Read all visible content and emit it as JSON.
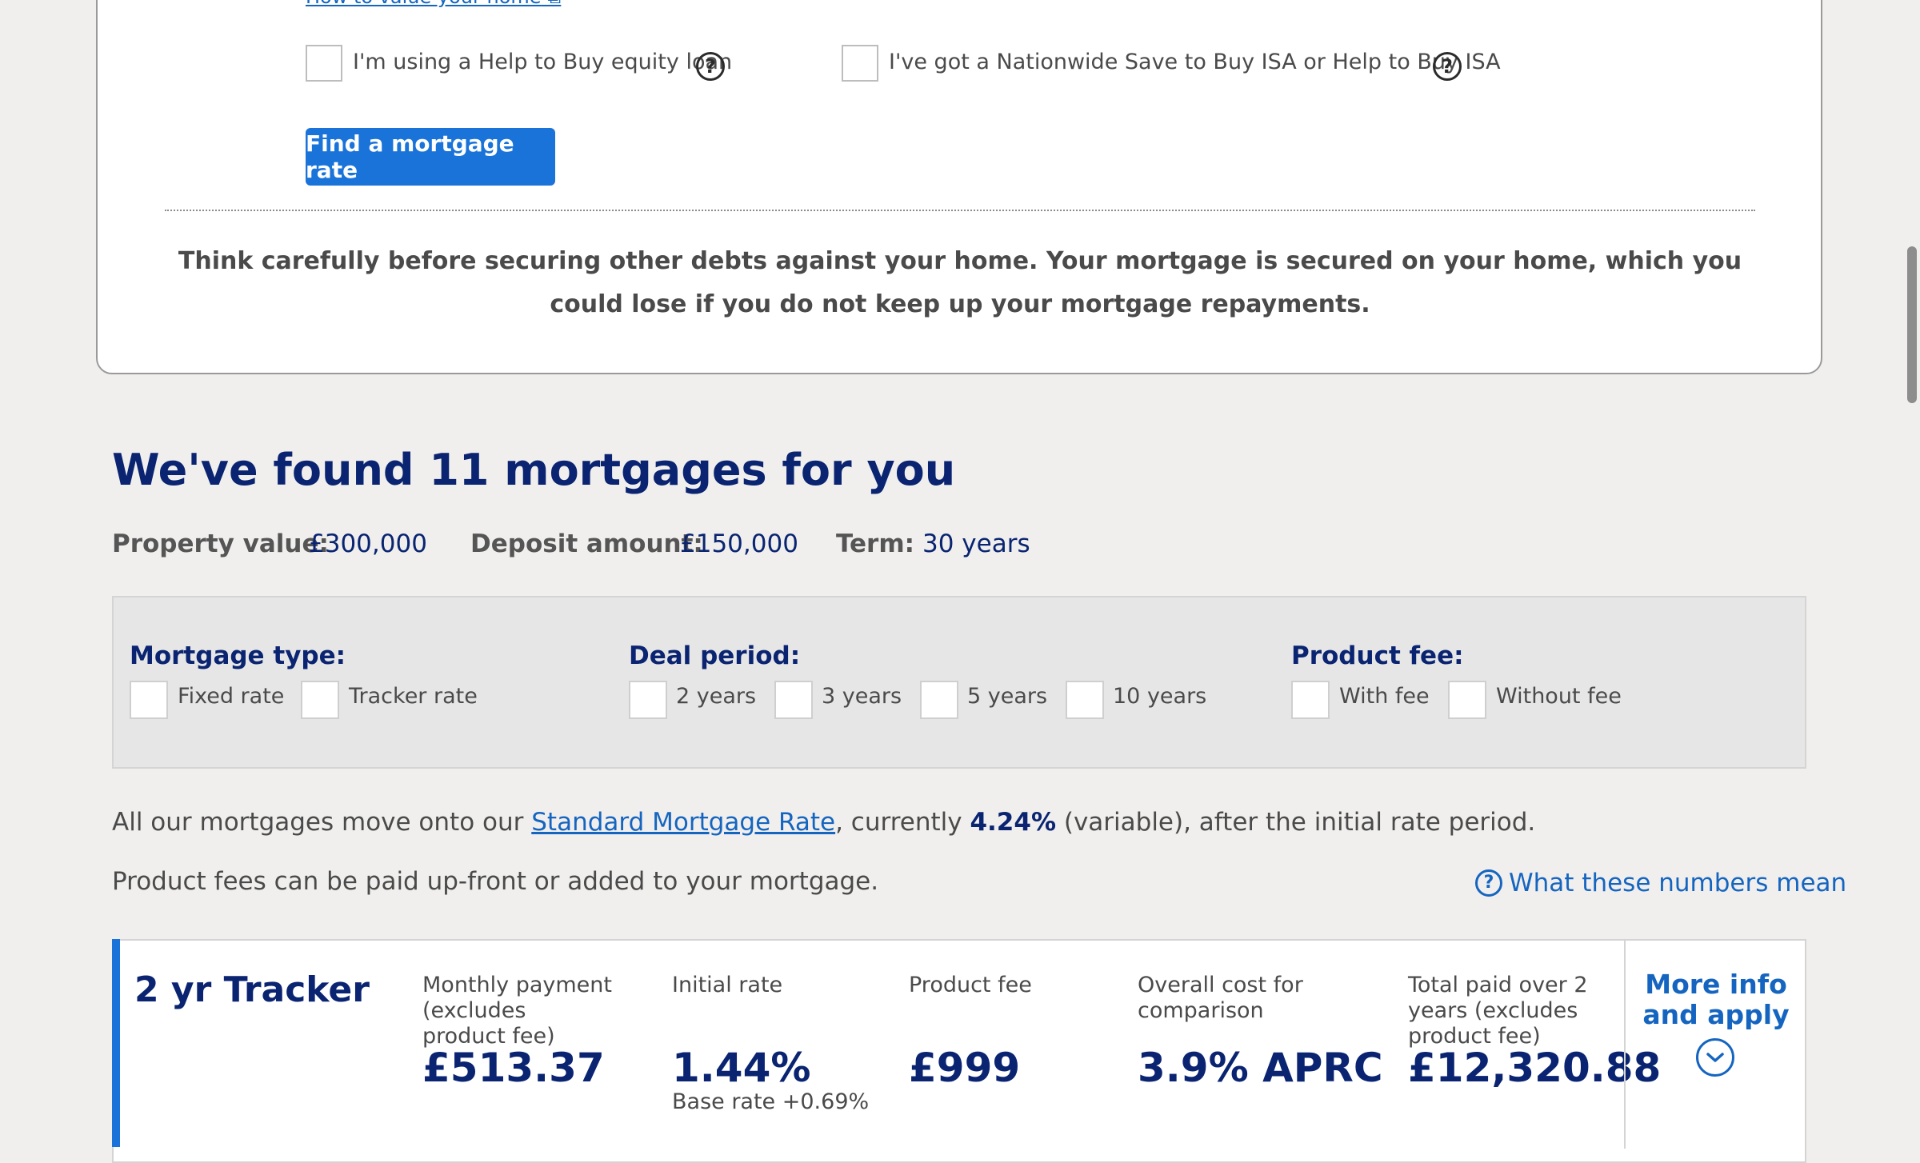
{
  "search_form": {
    "value_link": "How to value your home",
    "options": [
      {
        "label": "I'm using a Help to Buy equity loan"
      },
      {
        "label": "I've got a Nationwide Save to Buy ISA or Help to Buy ISA"
      }
    ],
    "help_glyph": "?",
    "find_button": "Find a mortgage rate",
    "warning": "Think carefully before securing other debts against your home. Your mortgage is secured on your home, which you could lose if you do not keep up your mortgage repayments."
  },
  "results": {
    "title": "We've found 11 mortgages for you",
    "summary": {
      "property_label": "Property value:",
      "property_value": "£300,000",
      "deposit_label": "Deposit amount:",
      "deposit_value": "£150,000",
      "term_label": "Term:",
      "term_value": "30 years"
    }
  },
  "filters": {
    "mortgage_type": {
      "title": "Mortgage type:",
      "options": [
        "Fixed rate",
        "Tracker rate"
      ]
    },
    "deal_period": {
      "title": "Deal period:",
      "options": [
        "2 years",
        "3 years",
        "5 years",
        "10 years"
      ]
    },
    "product_fee": {
      "title": "Product fee:",
      "options": [
        "With fee",
        "Without fee"
      ]
    }
  },
  "info": {
    "line1_pre": "All our mortgages move onto our ",
    "line1_link": "Standard Mortgage Rate",
    "line1_mid": ", currently ",
    "line1_rate": "4.24%",
    "line1_post": " (variable), after the initial rate period.",
    "line2": "Product fees can be paid up-front or added to your mortgage.",
    "numbers_link": "What these numbers mean"
  },
  "product": {
    "name": "2 yr Tracker",
    "columns": [
      {
        "label": "Monthly payment (excludes product fee)",
        "value": "£513.37"
      },
      {
        "label": "Initial rate",
        "value": "1.44%",
        "sub": "Base rate +0.69%"
      },
      {
        "label": "Product fee",
        "value": "£999"
      },
      {
        "label": "Overall cost for comparison",
        "value": "3.9% APRC"
      },
      {
        "label": "Total paid over 2 years (excludes product fee)",
        "value": "£12,320.88"
      }
    ],
    "more_info": "More info and apply"
  },
  "colors": {
    "accent": "#1a73d9",
    "heading": "#0a2471",
    "link": "#1565c0"
  },
  "icons": [
    "help-circle-icon",
    "chevron-down-circle-icon",
    "external-link-icon"
  ]
}
